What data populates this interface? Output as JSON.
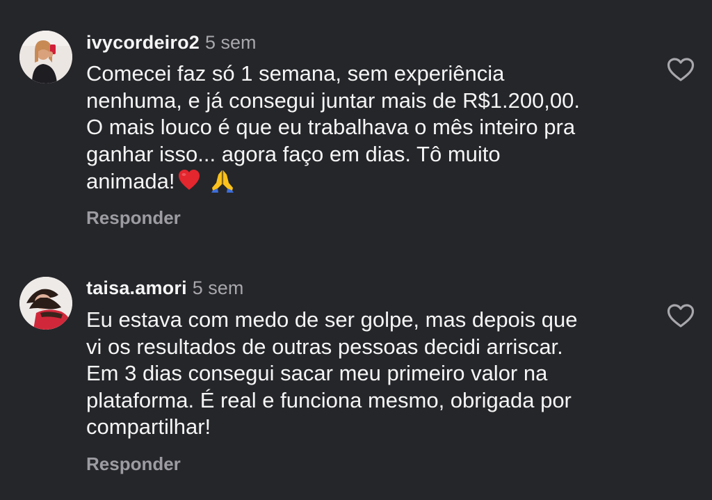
{
  "comments": [
    {
      "username": "ivycordeiro2",
      "time": "5 sem",
      "lines": [
        "Comecei faz só 1 semana, sem experiência",
        "nenhuma, e já consegui juntar mais de R$1.200,00.",
        "O mais louco é que eu trabalhava o mês inteiro pra",
        "ganhar isso... agora faço em dias. Tô muito",
        "animada!"
      ],
      "emojis": [
        "red-heart-emoji",
        "folded-hands-emoji"
      ],
      "reply_label": "Responder",
      "like_icon": "heart-outline-icon"
    },
    {
      "username": "taisa.amori",
      "time": "5 sem",
      "lines": [
        "Eu estava com medo de ser golpe, mas depois que",
        "vi os resultados de outras pessoas decidi arriscar.",
        "Em 3 dias consegui sacar meu primeiro valor na",
        "plataforma. É real e funciona mesmo, obrigada por",
        "compartilhar!"
      ],
      "reply_label": "Responder",
      "like_icon": "heart-outline-icon"
    }
  ],
  "colors": {
    "background": "#25262a",
    "text": "#f5f5f5",
    "muted": "#a8a8ac",
    "reply": "#9c9ca2"
  }
}
